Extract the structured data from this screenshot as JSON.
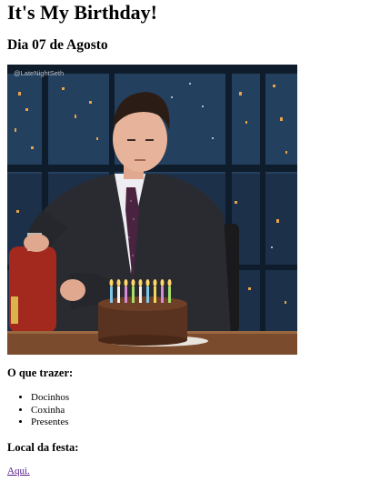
{
  "page": {
    "title": "It's My Birthday!",
    "subtitle": "Dia 07 de Agosto"
  },
  "media": {
    "watermark": "@LateNightSeth",
    "image": "man-cutting-birthday-cake-gif"
  },
  "bring": {
    "heading": "O que trazer:",
    "items": [
      "Docinhos",
      "Coxinha",
      "Presentes"
    ]
  },
  "location": {
    "heading": "Local da festa:",
    "link_label": "Aqui."
  },
  "colors": {
    "link": "#551a8b",
    "text": "#000000",
    "night_sky": "#1f3550",
    "desk": "#7a4b2c",
    "cake": "#5a3320"
  }
}
